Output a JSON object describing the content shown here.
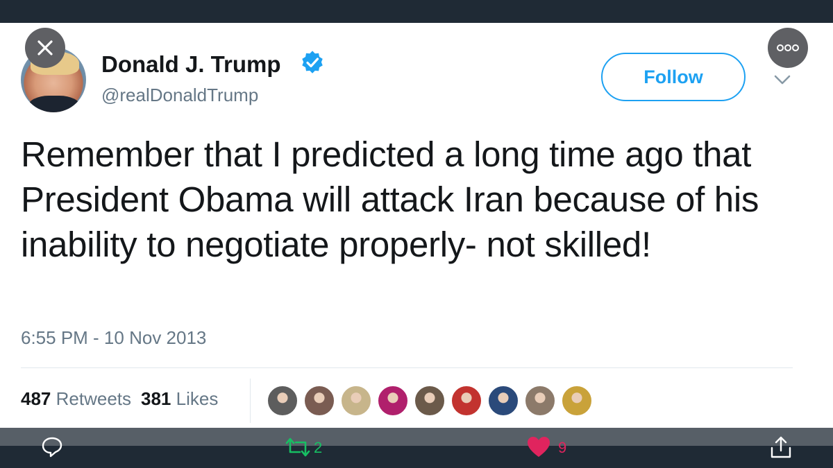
{
  "author": {
    "display_name": "Donald J. Trump",
    "handle": "@realDonaldTrump",
    "verified": true
  },
  "follow_label": "Follow",
  "tweet": {
    "text": "Remember that I predicted a long time ago that President Obama will attack Iran because of his inability to negotiate properly- not skilled!",
    "timestamp": "6:55 PM - 10 Nov 2013"
  },
  "stats": {
    "retweets_count": "487",
    "retweets_label": "Retweets",
    "likes_count": "381",
    "likes_label": "Likes"
  },
  "likers": [
    {
      "color": "#5d5d5d"
    },
    {
      "color": "#7a5c52"
    },
    {
      "color": "#c7b58b"
    },
    {
      "color": "#b0206c"
    },
    {
      "color": "#6b5a4a"
    },
    {
      "color": "#c2332f"
    },
    {
      "color": "#2b4a7a"
    },
    {
      "color": "#8c7a6a"
    },
    {
      "color": "#c9a23a"
    }
  ],
  "action_bar": {
    "retweet_count": "2",
    "like_count": "9"
  },
  "colors": {
    "accent": "#1da1f2",
    "like": "#e0245e",
    "retweet": "#17bf63",
    "chrome": "#1f2a35"
  }
}
